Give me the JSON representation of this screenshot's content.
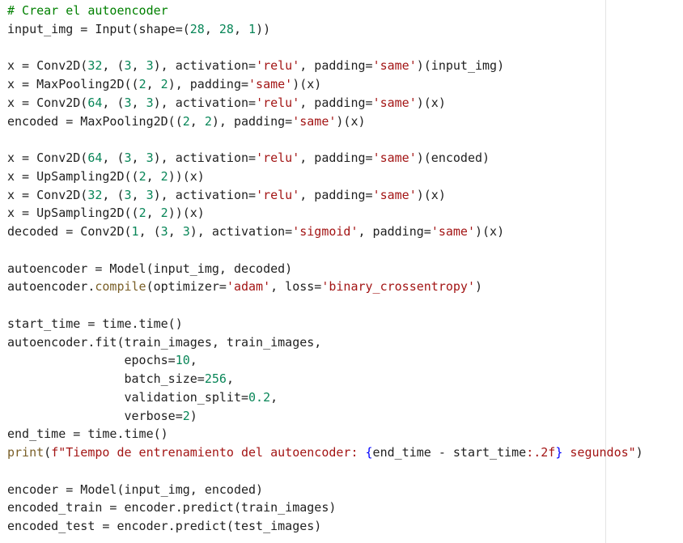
{
  "editor": {
    "lines": [
      [
        {
          "t": "# Crear el autoencoder",
          "k": "comment"
        }
      ],
      [
        {
          "t": "input_img = Input(shape=("
        },
        {
          "t": "28",
          "k": "number"
        },
        {
          "t": ", "
        },
        {
          "t": "28",
          "k": "number"
        },
        {
          "t": ", "
        },
        {
          "t": "1",
          "k": "number"
        },
        {
          "t": "))"
        }
      ],
      [],
      [
        {
          "t": "x = Conv2D("
        },
        {
          "t": "32",
          "k": "number"
        },
        {
          "t": ", ("
        },
        {
          "t": "3",
          "k": "number"
        },
        {
          "t": ", "
        },
        {
          "t": "3",
          "k": "number"
        },
        {
          "t": "), activation="
        },
        {
          "t": "'relu'",
          "k": "string"
        },
        {
          "t": ", padding="
        },
        {
          "t": "'same'",
          "k": "string"
        },
        {
          "t": ")(input_img)"
        }
      ],
      [
        {
          "t": "x = MaxPooling2D(("
        },
        {
          "t": "2",
          "k": "number"
        },
        {
          "t": ", "
        },
        {
          "t": "2",
          "k": "number"
        },
        {
          "t": "), padding="
        },
        {
          "t": "'same'",
          "k": "string"
        },
        {
          "t": ")(x)"
        }
      ],
      [
        {
          "t": "x = Conv2D("
        },
        {
          "t": "64",
          "k": "number"
        },
        {
          "t": ", ("
        },
        {
          "t": "3",
          "k": "number"
        },
        {
          "t": ", "
        },
        {
          "t": "3",
          "k": "number"
        },
        {
          "t": "), activation="
        },
        {
          "t": "'relu'",
          "k": "string"
        },
        {
          "t": ", padding="
        },
        {
          "t": "'same'",
          "k": "string"
        },
        {
          "t": ")(x)"
        }
      ],
      [
        {
          "t": "encoded = MaxPooling2D(("
        },
        {
          "t": "2",
          "k": "number"
        },
        {
          "t": ", "
        },
        {
          "t": "2",
          "k": "number"
        },
        {
          "t": "), padding="
        },
        {
          "t": "'same'",
          "k": "string"
        },
        {
          "t": ")(x)"
        }
      ],
      [],
      [
        {
          "t": "x = Conv2D("
        },
        {
          "t": "64",
          "k": "number"
        },
        {
          "t": ", ("
        },
        {
          "t": "3",
          "k": "number"
        },
        {
          "t": ", "
        },
        {
          "t": "3",
          "k": "number"
        },
        {
          "t": "), activation="
        },
        {
          "t": "'relu'",
          "k": "string"
        },
        {
          "t": ", padding="
        },
        {
          "t": "'same'",
          "k": "string"
        },
        {
          "t": ")(encoded)"
        }
      ],
      [
        {
          "t": "x = UpSampling2D(("
        },
        {
          "t": "2",
          "k": "number"
        },
        {
          "t": ", "
        },
        {
          "t": "2",
          "k": "number"
        },
        {
          "t": "))(x)"
        }
      ],
      [
        {
          "t": "x = Conv2D("
        },
        {
          "t": "32",
          "k": "number"
        },
        {
          "t": ", ("
        },
        {
          "t": "3",
          "k": "number"
        },
        {
          "t": ", "
        },
        {
          "t": "3",
          "k": "number"
        },
        {
          "t": "), activation="
        },
        {
          "t": "'relu'",
          "k": "string"
        },
        {
          "t": ", padding="
        },
        {
          "t": "'same'",
          "k": "string"
        },
        {
          "t": ")(x)"
        }
      ],
      [
        {
          "t": "x = UpSampling2D(("
        },
        {
          "t": "2",
          "k": "number"
        },
        {
          "t": ", "
        },
        {
          "t": "2",
          "k": "number"
        },
        {
          "t": "))(x)"
        }
      ],
      [
        {
          "t": "decoded = Conv2D("
        },
        {
          "t": "1",
          "k": "number"
        },
        {
          "t": ", ("
        },
        {
          "t": "3",
          "k": "number"
        },
        {
          "t": ", "
        },
        {
          "t": "3",
          "k": "number"
        },
        {
          "t": "), activation="
        },
        {
          "t": "'sigmoid'",
          "k": "string"
        },
        {
          "t": ", padding="
        },
        {
          "t": "'same'",
          "k": "string"
        },
        {
          "t": ")(x)"
        }
      ],
      [],
      [
        {
          "t": "autoencoder = Model(input_img, decoded)"
        }
      ],
      [
        {
          "t": "autoencoder."
        },
        {
          "t": "compile",
          "k": "builtin"
        },
        {
          "t": "(optimizer="
        },
        {
          "t": "'adam'",
          "k": "string"
        },
        {
          "t": ", loss="
        },
        {
          "t": "'binary_crossentropy'",
          "k": "string"
        },
        {
          "t": ")"
        }
      ],
      [],
      [
        {
          "t": "start_time = time.time()"
        }
      ],
      [
        {
          "t": "autoencoder.fit(train_images, train_images,"
        }
      ],
      [
        {
          "t": "                epochs="
        },
        {
          "t": "10",
          "k": "number"
        },
        {
          "t": ","
        }
      ],
      [
        {
          "t": "                batch_size="
        },
        {
          "t": "256",
          "k": "number"
        },
        {
          "t": ","
        }
      ],
      [
        {
          "t": "                validation_split="
        },
        {
          "t": "0.2",
          "k": "number"
        },
        {
          "t": ","
        }
      ],
      [
        {
          "t": "                verbose="
        },
        {
          "t": "2",
          "k": "number"
        },
        {
          "t": ")"
        }
      ],
      [
        {
          "t": "end_time = time.time()"
        }
      ],
      [
        {
          "t": "print",
          "k": "builtin"
        },
        {
          "t": "("
        },
        {
          "t": "f\"Tiempo de entrenamiento del autoencoder: ",
          "k": "string"
        },
        {
          "t": "{",
          "k": "interp"
        },
        {
          "t": "end_time - start_time"
        },
        {
          "t": ":.2f",
          "k": "string"
        },
        {
          "t": "}",
          "k": "interp"
        },
        {
          "t": " segundos\"",
          "k": "string"
        },
        {
          "t": ")"
        }
      ],
      [],
      [
        {
          "t": "encoder = Model(input_img, encoded)"
        }
      ],
      [
        {
          "t": "encoded_train = encoder.predict(train_images)"
        }
      ],
      [
        {
          "t": "encoded_test = encoder.predict(test_images)"
        }
      ]
    ]
  },
  "colors": {
    "background": "#ffffff",
    "default_text": "#212121",
    "comment": "#008000",
    "number": "#098658",
    "string": "#a31515",
    "builtin": "#795e26",
    "interp": "#0000ff",
    "ruler": "#e3e3e3"
  }
}
